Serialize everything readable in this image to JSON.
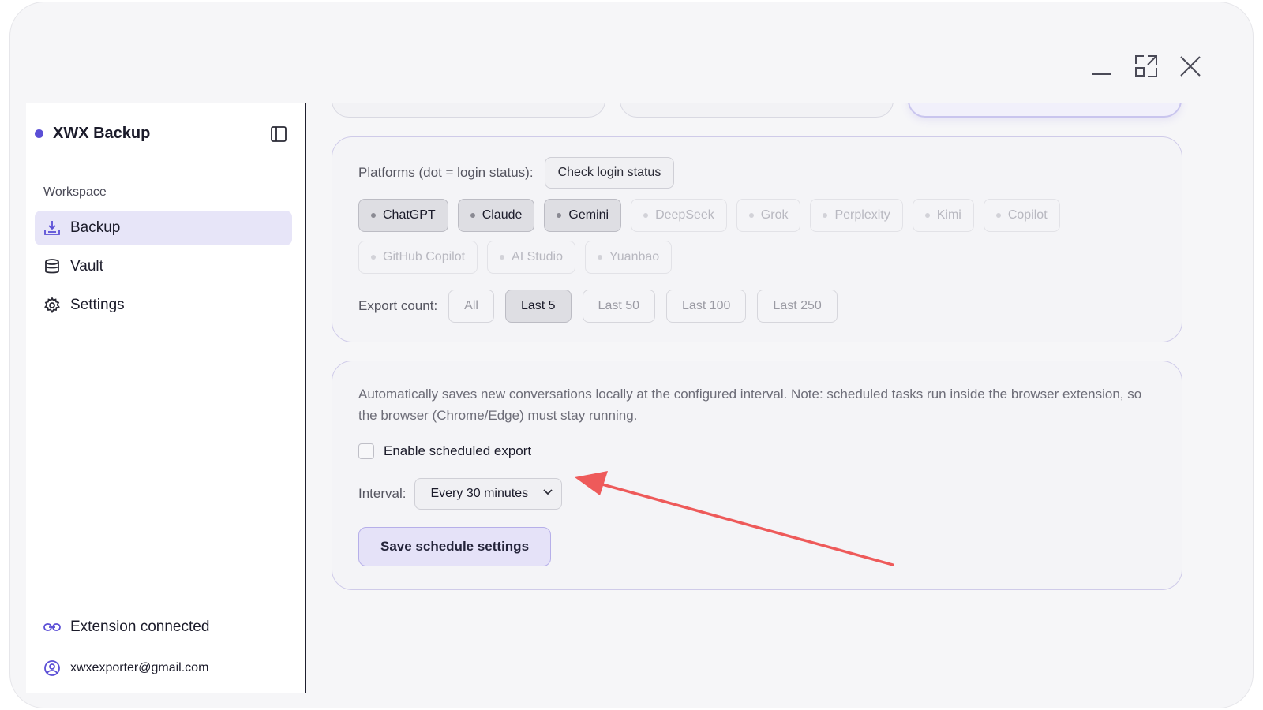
{
  "window": {
    "controls": [
      "minimize-icon",
      "maximize-icon",
      "close-icon"
    ]
  },
  "sidebar": {
    "brand": "XWX Backup",
    "section_label": "Workspace",
    "items": [
      {
        "label": "Backup",
        "icon": "download-tray-icon",
        "active": true
      },
      {
        "label": "Vault",
        "icon": "database-icon",
        "active": false
      },
      {
        "label": "Settings",
        "icon": "gear-icon",
        "active": false
      }
    ],
    "footer": {
      "status": "Extension connected",
      "email": "xwxexporter@gmail.com"
    }
  },
  "platforms": {
    "label": "Platforms (dot = login status):",
    "check_button": "Check login status",
    "items": [
      {
        "name": "ChatGPT",
        "selected": true
      },
      {
        "name": "Claude",
        "selected": true
      },
      {
        "name": "Gemini",
        "selected": true
      },
      {
        "name": "DeepSeek",
        "selected": false
      },
      {
        "name": "Grok",
        "selected": false
      },
      {
        "name": "Perplexity",
        "selected": false
      },
      {
        "name": "Kimi",
        "selected": false
      },
      {
        "name": "Copilot",
        "selected": false
      },
      {
        "name": "GitHub Copilot",
        "selected": false
      },
      {
        "name": "AI Studio",
        "selected": false
      },
      {
        "name": "Yuanbao",
        "selected": false
      }
    ]
  },
  "export_count": {
    "label": "Export count:",
    "options": [
      "All",
      "Last 5",
      "Last 50",
      "Last 100",
      "Last 250"
    ],
    "selected": "Last 5"
  },
  "schedule": {
    "description": "Automatically saves new conversations locally at the configured interval. Note: scheduled tasks run inside the browser extension, so the browser (Chrome/Edge) must stay running.",
    "enable_label": "Enable scheduled export",
    "enabled": false,
    "interval_label": "Interval:",
    "interval_value": "Every 30 minutes",
    "save_button": "Save schedule settings"
  },
  "annotation": {
    "arrow_color": "#ee5a5a"
  }
}
